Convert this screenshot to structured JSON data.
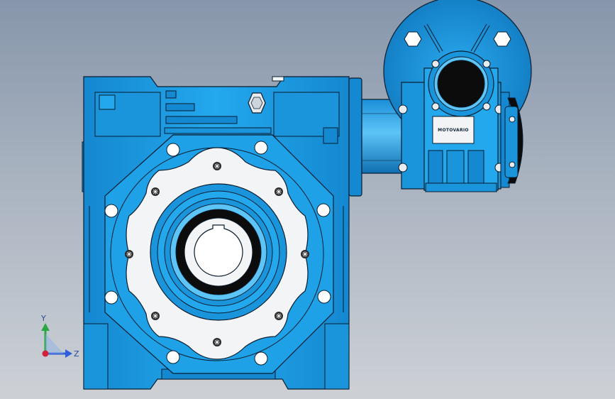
{
  "viewport": {
    "background_top": "#8796ab",
    "background_bottom": "#cdd1d6"
  },
  "model": {
    "body_color": "#1fa1e8",
    "body_shadow": "#0f6fb2",
    "outline": "#0a1c2c",
    "flange_color": "#f2f4f6",
    "bore_color": "#ffffff",
    "seal_color": "#0c0c0c"
  },
  "nameplate": {
    "brand": "MOTOVARIO"
  },
  "triad": {
    "y_label": "Y",
    "z_label": "Z",
    "y_color": "#2aa745",
    "z_color": "#2f5fd8",
    "x_color": "#d0203a"
  }
}
